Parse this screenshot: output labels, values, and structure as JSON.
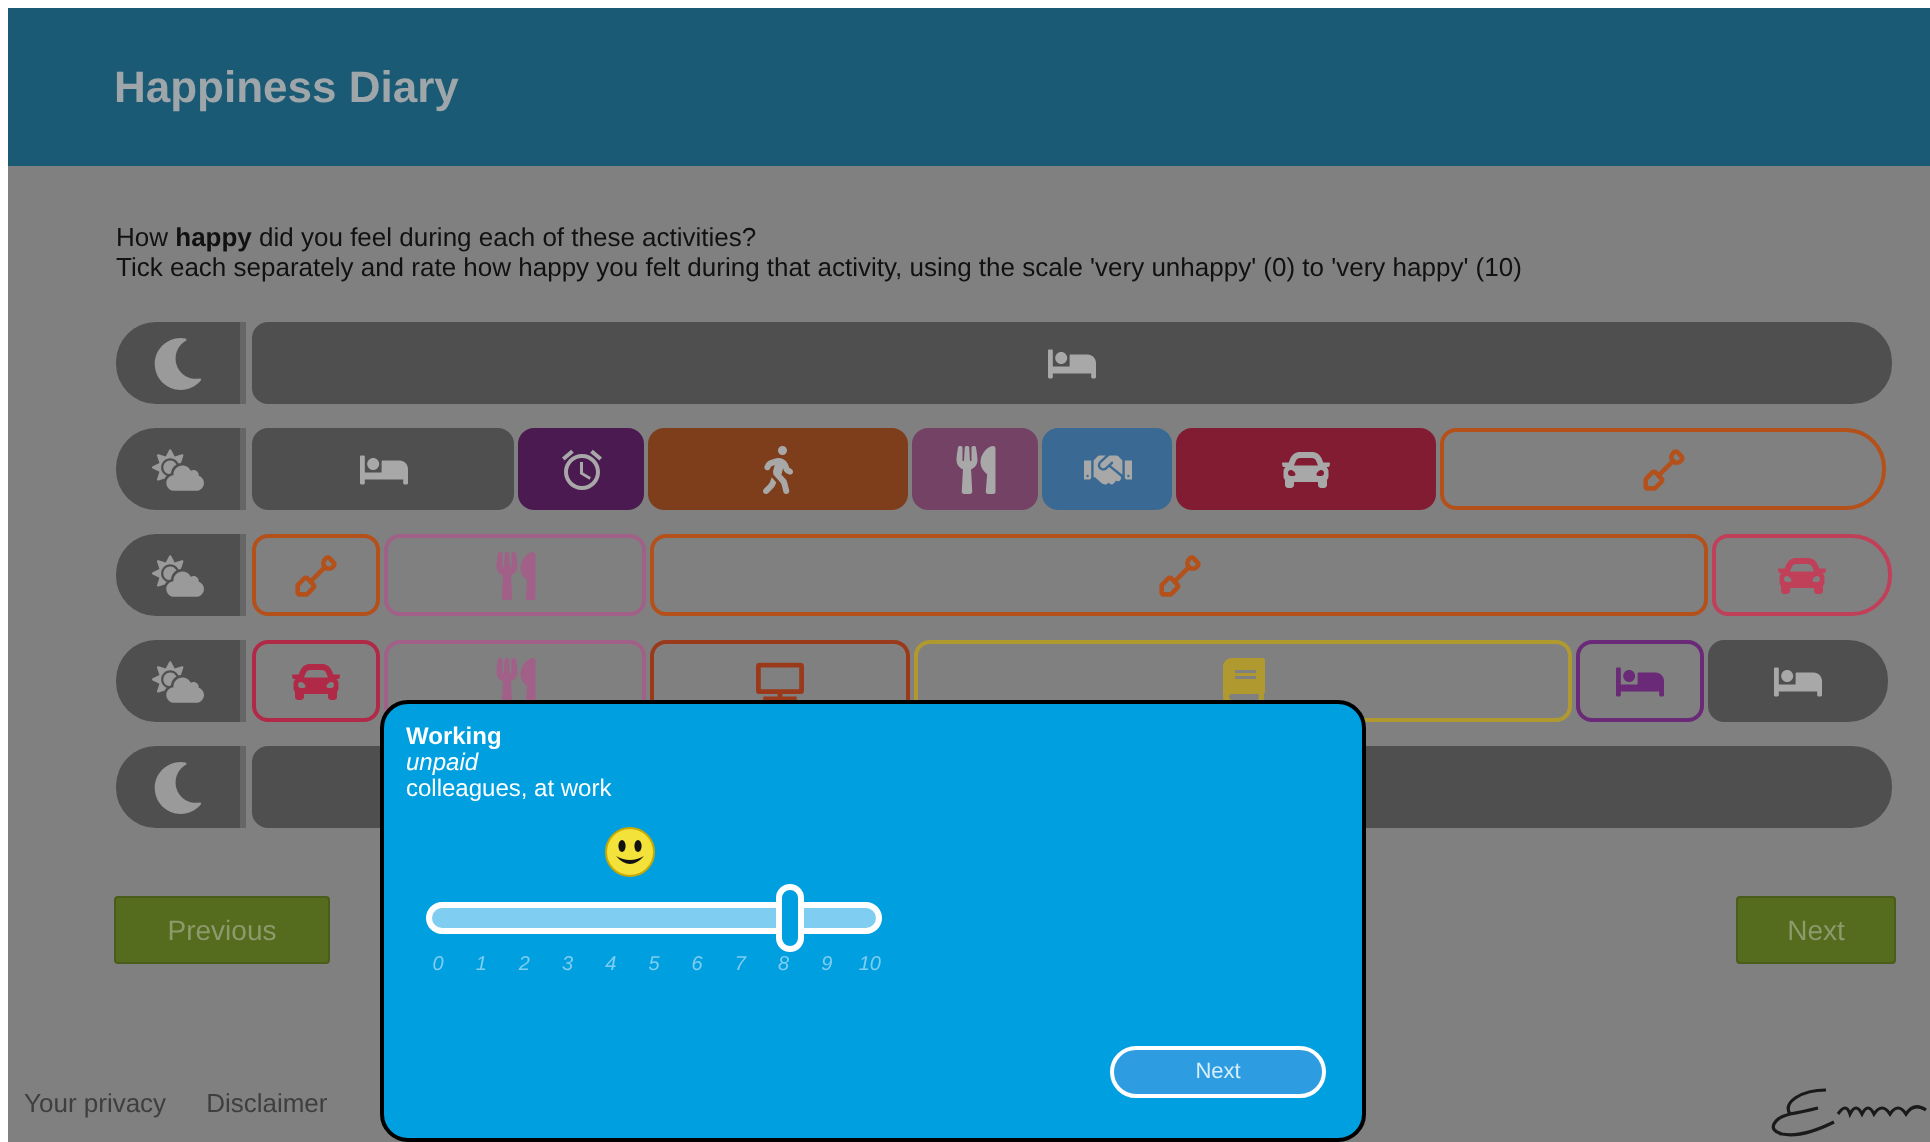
{
  "header": {
    "title": "Happiness Diary"
  },
  "instructions": [
    "How **happy** did you feel during each of these activities?",
    "Tick each separately and rate how happy you felt during that activity, using the scale 'very unhappy' (0) to 'very happy' (10)"
  ],
  "rows": [
    {
      "kind": "moon",
      "segments": [
        {
          "kind": "bed",
          "filled": true,
          "color": "#4f4f4f"
        }
      ]
    },
    {
      "kind": "sun-cloud",
      "segments": [
        {
          "kind": "bed",
          "filled": true,
          "color": "#4f4f4f"
        },
        {
          "kind": "alarm",
          "filled": true,
          "color": "#4a1a50"
        },
        {
          "kind": "walk",
          "filled": true,
          "color": "#7e3e1c"
        },
        {
          "kind": "eat",
          "filled": true,
          "color": "#744265"
        },
        {
          "kind": "handshake",
          "filled": true,
          "color": "#3a6a93"
        },
        {
          "kind": "car",
          "filled": true,
          "color": "#811c33"
        },
        {
          "kind": "work",
          "filled": false,
          "color": "#b4501a"
        }
      ]
    },
    {
      "kind": "sun-cloud",
      "segments": [
        {
          "kind": "work",
          "filled": false,
          "color": "#b4501a"
        },
        {
          "kind": "eat",
          "filled": false,
          "color": "#a06088"
        },
        {
          "kind": "work",
          "filled": false,
          "color": "#b4501a"
        },
        {
          "kind": "car",
          "filled": false,
          "color": "#c0405a"
        }
      ]
    },
    {
      "kind": "sun-cloud",
      "segments": [
        {
          "kind": "car",
          "filled": false,
          "color": "#b02a48"
        },
        {
          "kind": "eat",
          "filled": false,
          "color": "#a06088"
        },
        {
          "kind": "tv",
          "filled": false,
          "color": "#9a3a1a"
        },
        {
          "kind": "book",
          "filled": false,
          "color": "#b09a30"
        },
        {
          "kind": "bed",
          "filled": false,
          "color": "#6a2a78"
        },
        {
          "kind": "bed",
          "filled": true,
          "color": "#4f4f4f"
        }
      ]
    },
    {
      "kind": "moon",
      "segments": [
        {
          "kind": "none",
          "filled": true,
          "color": "#4f4f4f"
        }
      ]
    }
  ],
  "buttons": {
    "previous": "Previous",
    "next": "Next"
  },
  "footer": [
    "Your privacy",
    "Disclaimer"
  ],
  "dialog": {
    "title": "Working",
    "subtitle": "unpaid",
    "detail": "colleagues, at work",
    "slider": {
      "level": 0.8
    },
    "scale": [
      "0",
      "1",
      "2",
      "3",
      "4",
      "5",
      "6",
      "7",
      "8",
      "9",
      "10"
    ],
    "button": "Next"
  }
}
